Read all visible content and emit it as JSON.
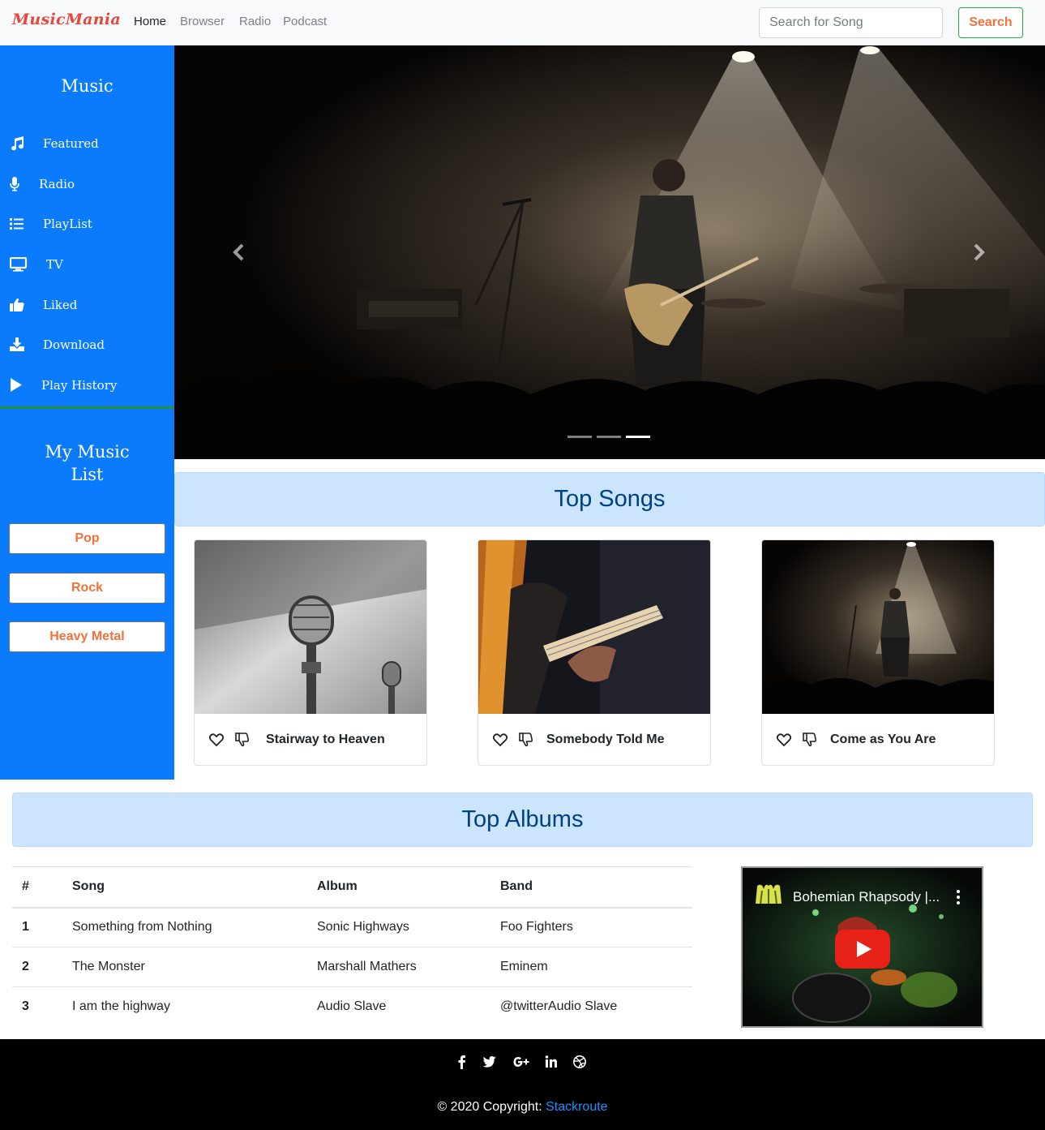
{
  "navbar": {
    "brand": "MusicMania",
    "links": [
      {
        "label": "Home",
        "active": true
      },
      {
        "label": "Browser",
        "active": false
      },
      {
        "label": "Radio",
        "active": false
      },
      {
        "label": "Podcast",
        "active": false
      }
    ],
    "search_placeholder": "Search for Song",
    "search_button": "Search"
  },
  "sidebar": {
    "title": "Music",
    "items": [
      {
        "label": "Featured",
        "icon": "music-note-icon"
      },
      {
        "label": "Radio",
        "icon": "microphone-icon"
      },
      {
        "label": "PlayList",
        "icon": "list-icon"
      },
      {
        "label": "TV",
        "icon": "tv-icon"
      },
      {
        "label": "Liked",
        "icon": "thumbs-up-icon"
      },
      {
        "label": "Download",
        "icon": "download-icon"
      },
      {
        "label": "Play History",
        "icon": "play-icon"
      }
    ],
    "my_list_title_line1": "My Music",
    "my_list_title_line2": "List",
    "genres": [
      "Pop",
      "Rock",
      "Heavy Metal"
    ]
  },
  "carousel": {
    "slide_count": 3,
    "active_slide": 3
  },
  "top_songs": {
    "title": "Top Songs",
    "songs": [
      {
        "title": "Stairway to Heaven",
        "image": "microphone-photo"
      },
      {
        "title": "Somebody Told Me",
        "image": "guitar-closeup-photo"
      },
      {
        "title": "Come as You Are",
        "image": "concert-stage-photo"
      }
    ]
  },
  "top_albums": {
    "title": "Top Albums",
    "columns": [
      "#",
      "Song",
      "Album",
      "Band"
    ],
    "rows": [
      [
        "1",
        "Something from Nothing",
        "Sonic Highways",
        "Foo Fighters"
      ],
      [
        "2",
        "The Monster",
        "Marshall Mathers",
        "Eminem"
      ],
      [
        "3",
        "I am the highway",
        "Audio Slave",
        "@twitterAudio Slave"
      ]
    ]
  },
  "video": {
    "title": "Bohemian Rhapsody |..."
  },
  "footer": {
    "social_icons": [
      "facebook-icon",
      "twitter-icon",
      "google-plus-icon",
      "linkedin-icon",
      "dribbble-icon"
    ],
    "copyright_text": "© 2020 Copyright: ",
    "copyright_link": "Stackroute"
  },
  "colors": {
    "sidebar_bg": "#0a7bfc",
    "brand_red": "#e8453c",
    "accent_orange": "#f0723a",
    "alert_bg": "#cce5ff",
    "alert_text": "#004085",
    "link_blue": "#1e90ff"
  }
}
